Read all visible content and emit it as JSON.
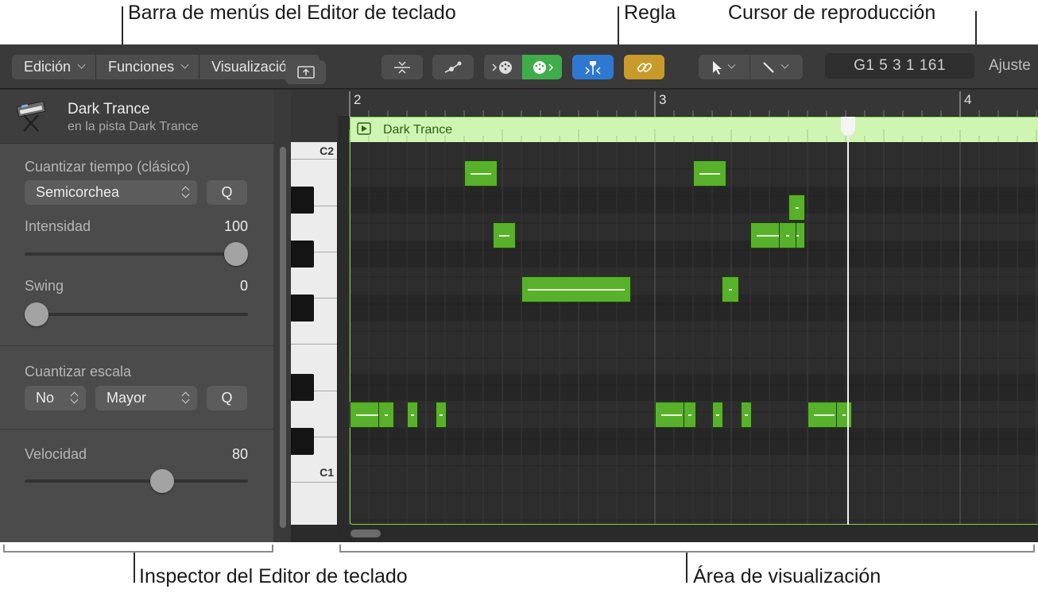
{
  "callouts": {
    "menubar": "Barra de menús del Editor de teclado",
    "ruler": "Regla",
    "playhead": "Cursor de reproducción",
    "inspector": "Inspector del Editor de teclado",
    "display_area": "Área de visualización"
  },
  "toolbar": {
    "menus": [
      "Edición",
      "Funciones",
      "Visualización"
    ],
    "position_display": "G1   5 3 1 161",
    "ajuste_label": "Ajuste",
    "colors": {
      "midi_in": "#3fae4a",
      "catch": "#2e78d2",
      "link": "#c89a2a"
    }
  },
  "inspector": {
    "track_name": "Dark Trance",
    "track_sub": "en la pista Dark Trance",
    "time_quantize_label": "Cuantizar tiempo (clásico)",
    "time_quantize_value": "Semicorchea",
    "q_label": "Q",
    "strength_label": "Intensidad",
    "strength_value": "100",
    "strength_level": 1.0,
    "swing_label": "Swing",
    "swing_value": "0",
    "swing_level": 0.0,
    "scale_quantize_label": "Cuantizar escala",
    "scale_root_value": "No",
    "scale_type_value": "Mayor",
    "velocity_label": "Velocidad",
    "velocity_value": "80",
    "velocity_level": 0.63
  },
  "piano": {
    "labels": [
      "C2",
      "C1"
    ]
  },
  "ruler": {
    "bars": [
      "2",
      "3",
      "4"
    ]
  },
  "region": {
    "name": "Dark Trance",
    "color": "#cff5b3"
  },
  "notes": [
    {
      "beat": 1.0,
      "len": 0.25,
      "row": 5
    },
    {
      "beat": 1.38,
      "len": 0.1,
      "row": 5
    },
    {
      "beat": 1.75,
      "len": 0.06,
      "row": 5
    },
    {
      "beat": 2.13,
      "len": 0.06,
      "row": 5
    },
    {
      "beat": 2.5,
      "len": 0.22,
      "row": 1
    },
    {
      "beat": 2.88,
      "len": 0.15,
      "row": 2
    },
    {
      "beat": 3.25,
      "len": 0.72,
      "row": 3
    },
    {
      "beat": 5.0,
      "len": 0.22,
      "row": 5
    },
    {
      "beat": 5.38,
      "len": 0.08,
      "row": 5
    },
    {
      "beat": 5.75,
      "len": 0.06,
      "row": 5
    },
    {
      "beat": 6.13,
      "len": 0.06,
      "row": 5
    },
    {
      "beat": 5.5,
      "len": 0.22,
      "row": 1
    },
    {
      "beat": 5.88,
      "len": 0.11,
      "row": 3
    },
    {
      "beat": 6.25,
      "len": 0.36,
      "row": 2
    },
    {
      "beat": 6.63,
      "len": 0.11,
      "row": 2
    },
    {
      "beat": 6.75,
      "len": 0.11,
      "row": 1.5
    },
    {
      "beat": 7.0,
      "len": 0.22,
      "row": 5
    },
    {
      "beat": 7.38,
      "len": 0.1,
      "row": 5
    }
  ],
  "playhead_beat": 7.25
}
